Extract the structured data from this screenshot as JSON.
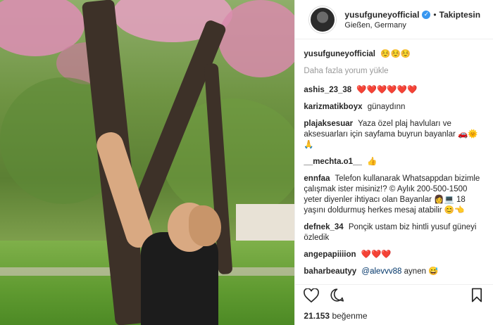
{
  "post": {
    "username": "yusufguneyofficial",
    "follow_label": "Takiptesin",
    "separator": "•",
    "location": "Gießen, Germany",
    "caption_text": "☺️☺️☺️",
    "load_more": "Daha fazla yorum yükle",
    "comments": [
      {
        "user": "ashis_23_38",
        "text": "❤️❤️❤️❤️❤️❤️"
      },
      {
        "user": "karizmatikboyx",
        "text": "günaydınn"
      },
      {
        "user": "plajaksesuar",
        "text": "Yaza özel plaj havluları ve aksesuarları için sayfama buyrun bayanlar 🚗🌞🙏"
      },
      {
        "user": "__mechta.o1__",
        "text": "👍"
      },
      {
        "user": "ennfaa",
        "text": "Telefon kullanarak Whatsappdan bizimle çalışmak ister misiniz!? © Aylık 200-500-1500 yeter diyenler ihtiyacı olan Bayanlar 👩💻 18 yaşını doldurmuş herkes mesaj atabilir 😊👈"
      },
      {
        "user": "defnek_34",
        "text": "Ponçik ustam biz hintli yusuf güneyi özledik"
      },
      {
        "user": "angepapiiiion",
        "text": "❤️❤️❤️"
      },
      {
        "user": "baharbeautyy",
        "mention": "@alevvv88",
        "text": "aynen 😅"
      }
    ],
    "likes_count": "21.153",
    "likes_label": "beğenme"
  },
  "icons": {
    "verified": "verified-badge-icon",
    "like": "heart-icon",
    "comment": "comment-icon",
    "save": "bookmark-icon"
  },
  "colors": {
    "verified": "#3897f0",
    "muted": "#999999",
    "text": "#262626",
    "mention": "#003569"
  }
}
